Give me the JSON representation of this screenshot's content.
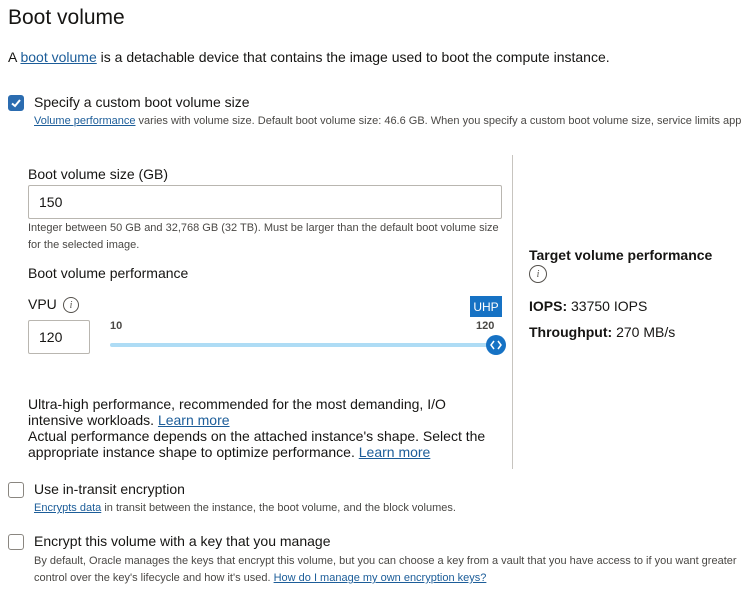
{
  "section": {
    "title": "Boot volume",
    "intro_prefix": "A ",
    "intro_link": "boot volume",
    "intro_suffix": " is a detachable device that contains the image used to boot the compute instance."
  },
  "custom_size": {
    "checked": true,
    "label": "Specify a custom boot volume size",
    "help_link": "Volume performance",
    "help_text": " varies with volume size. Default boot volume size: 46.6 GB. When you specify a custom boot volume size, service limits apply."
  },
  "size_field": {
    "label": "Boot volume size (GB)",
    "value": "150",
    "help_line1": "Integer between 50 GB and 32,768 GB (32 TB). Must be larger than the default boot volume size",
    "help_line2": "for the selected image."
  },
  "performance": {
    "label": "Boot volume performance",
    "vpu_label": "VPU",
    "vpu_value": "120",
    "slider_min": "10",
    "slider_max": "120",
    "slider_level": 1.0,
    "badge": "UHP",
    "description_line1": "Ultra-high performance, recommended for the most demanding, I/O",
    "description_line2": "intensive workloads. ",
    "description_link1": "Learn more",
    "description_line3": "Actual performance depends on the attached instance's shape. Select the",
    "description_line4": "appropriate instance shape to optimize performance. ",
    "description_link2": "Learn more"
  },
  "target": {
    "heading": "Target volume performance",
    "iops_label": "IOPS:",
    "iops_value": " 33750 IOPS",
    "throughput_label": "Throughput:",
    "throughput_value": " 270 MB/s"
  },
  "transit": {
    "checked": false,
    "label": "Use in-transit encryption",
    "help_link": "Encrypts data",
    "help_text": " in transit between the instance, the boot volume, and the block volumes."
  },
  "encrypt_key": {
    "checked": false,
    "label": "Encrypt this volume with a key that you manage",
    "help_line1": "By default, Oracle manages the keys that encrypt this volume, but you can choose a key from a vault that you have access to if you want greater",
    "help_line2": "control over the key's lifecycle and how it's used. ",
    "help_link": "How do I manage my own encryption keys?"
  },
  "icons": {
    "check": "check-icon",
    "info": "info-icon",
    "slider_handle": "chevrons-left-right-icon"
  },
  "colors": {
    "link": "#1c5d99",
    "accent": "#1672c4",
    "track": "#aedcf5"
  }
}
